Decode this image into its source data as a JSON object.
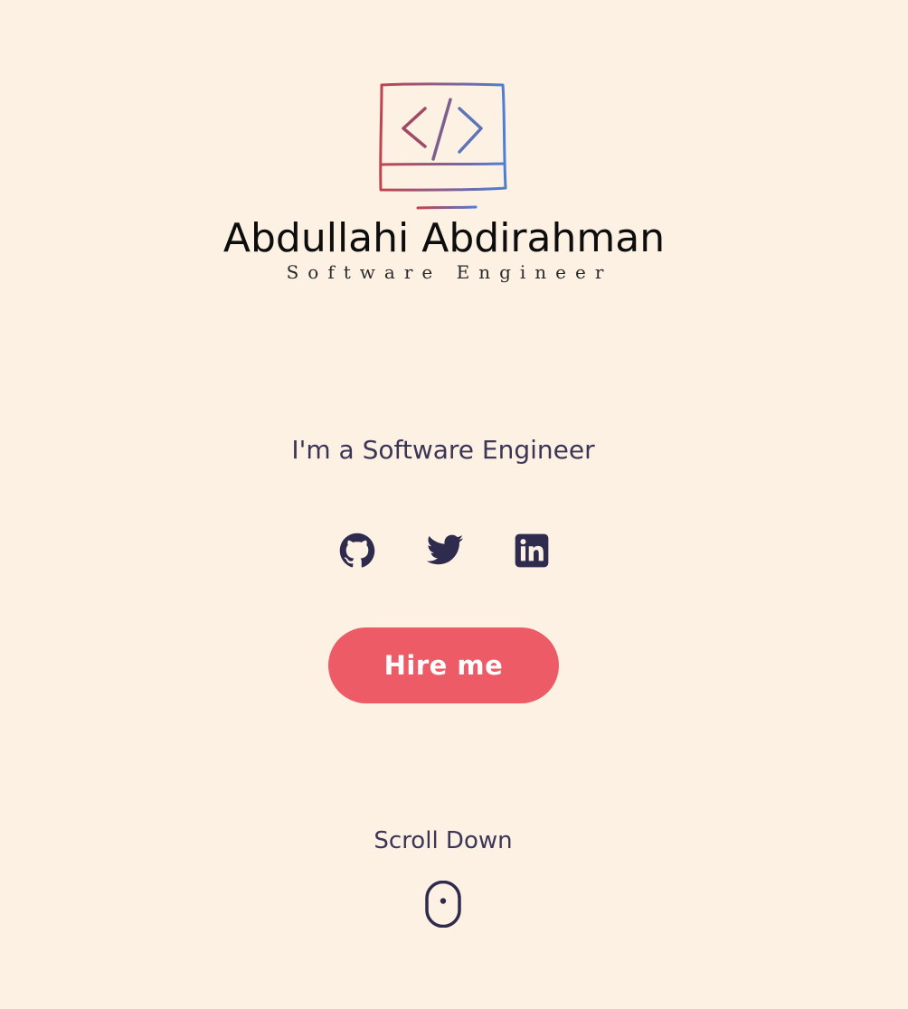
{
  "logo": {
    "name": "Abdullahi Abdirahman",
    "tagline": "Software Engineer",
    "icon": "computer-code-icon",
    "gradient": [
      "#c0444e",
      "#4b7fd6"
    ]
  },
  "hero": {
    "headline": "I'm a Software Engineer"
  },
  "socials": [
    {
      "label": "GitHub",
      "icon": "github-icon"
    },
    {
      "label": "Twitter",
      "icon": "twitter-icon"
    },
    {
      "label": "LinkedIn",
      "icon": "linkedin-icon"
    }
  ],
  "cta": {
    "label": "Hire me",
    "color": "#ec5b66"
  },
  "scroll": {
    "label": "Scroll Down",
    "icon": "mouse-icon"
  },
  "colors": {
    "background": "#fdf1e4",
    "text": "#3b3556",
    "icon": "#2f2b4e"
  }
}
